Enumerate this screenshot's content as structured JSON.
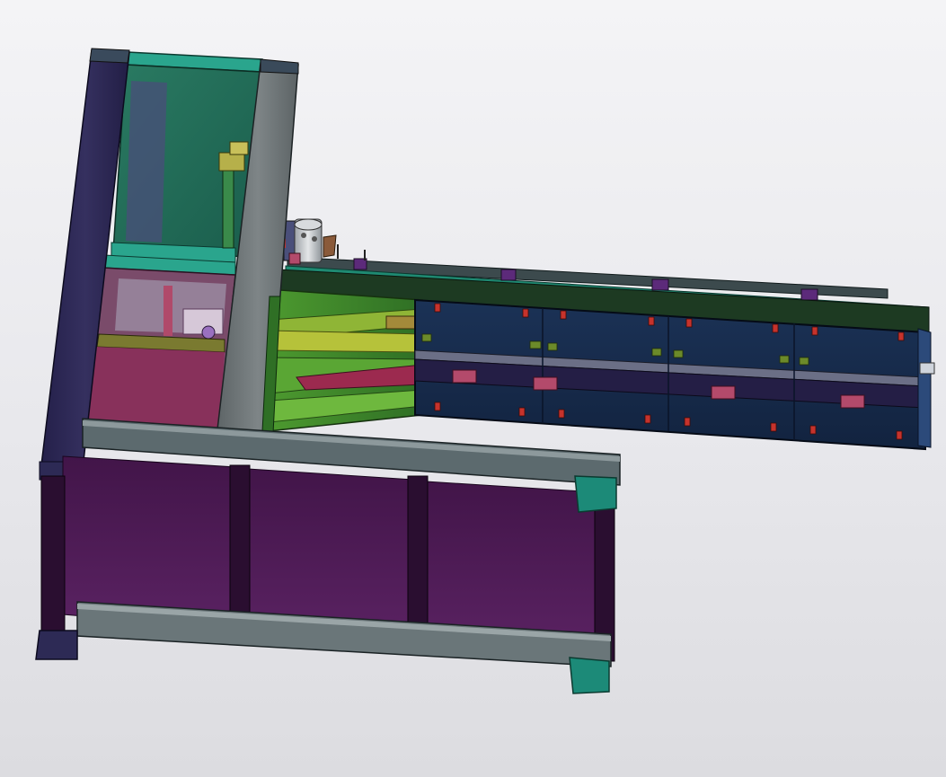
{
  "viewport": {
    "background_top": "#f4f4f6",
    "background_bottom": "#dcdce0"
  },
  "model": {
    "palette": {
      "dark_post": "#2d2a55",
      "post_edge": "#1a1838",
      "teal": "#1c8a78",
      "teal_light": "#2aa58d",
      "glass_green": "#1f6f5a",
      "gray_frame": "#6d7476",
      "gray_light": "#8d9495",
      "purple_panel": "#4b1a52",
      "purple_mid": "#5a2061",
      "navy_box": "#172a4a",
      "navy_dark": "#0e1b33",
      "chute_green": "#3e8f2e",
      "chute_yellow": "#7a8a25",
      "red_clip": "#c6332c",
      "magenta_block": "#b34a6b",
      "motor_gray": "#c8cbcf",
      "violet_bracket": "#5c2a7a"
    },
    "parts": [
      "left-post",
      "upper-cabinet-glass",
      "upper-cabinet-shelf",
      "lower-cabinet",
      "vertical-column",
      "base-frame-top-rail",
      "base-frame-bottom-rail",
      "base-purple-panels",
      "corner-feet",
      "motor",
      "conveyor-top-rail",
      "conveyor-box",
      "feed-chute"
    ]
  }
}
